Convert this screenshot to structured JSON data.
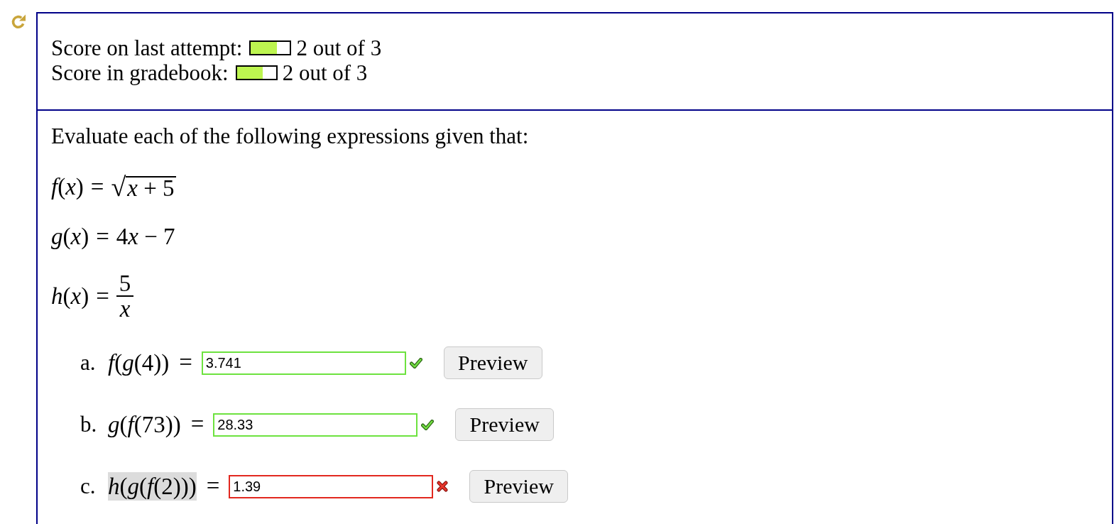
{
  "scores": [
    {
      "label": "Score on last attempt:",
      "level": 0.667,
      "value": "2 out of 3"
    },
    {
      "label": "Score in gradebook:",
      "level": 0.667,
      "value": "2 out of 3"
    }
  ],
  "prompt": "Evaluate each of the following expressions given that:",
  "definitions": [
    {
      "kind": "sqrt",
      "name": "*f*(*x*)",
      "equals": "=",
      "radical": "√",
      "radicand": "*x* + 5"
    },
    {
      "kind": "plain",
      "name": "*g*(*x*)",
      "equals": "=",
      "runs": [
        {
          "text": "4",
          "italic": false
        },
        {
          "text": "x",
          "italic": true
        },
        {
          "text": " − 7",
          "italic": false
        }
      ]
    },
    {
      "kind": "fraction",
      "name": "*h*(*x*)",
      "equals": "=",
      "numerator": "5",
      "denominator": "x"
    }
  ],
  "questions": [
    {
      "label": "a.",
      "expression": "*f*(*g*(4))",
      "highlighted": false,
      "equals": "=",
      "answer": "3.741",
      "correct": true,
      "button": "Preview"
    },
    {
      "label": "b.",
      "expression": "*g*(*f*(73))",
      "highlighted": false,
      "equals": "=",
      "answer": "28.33",
      "correct": true,
      "button": "Preview"
    },
    {
      "label": "c.",
      "expression": "*h*(*g*(*f*(2)))",
      "highlighted": true,
      "equals": "=",
      "answer": "1.39",
      "correct": false,
      "button": "Preview"
    }
  ]
}
